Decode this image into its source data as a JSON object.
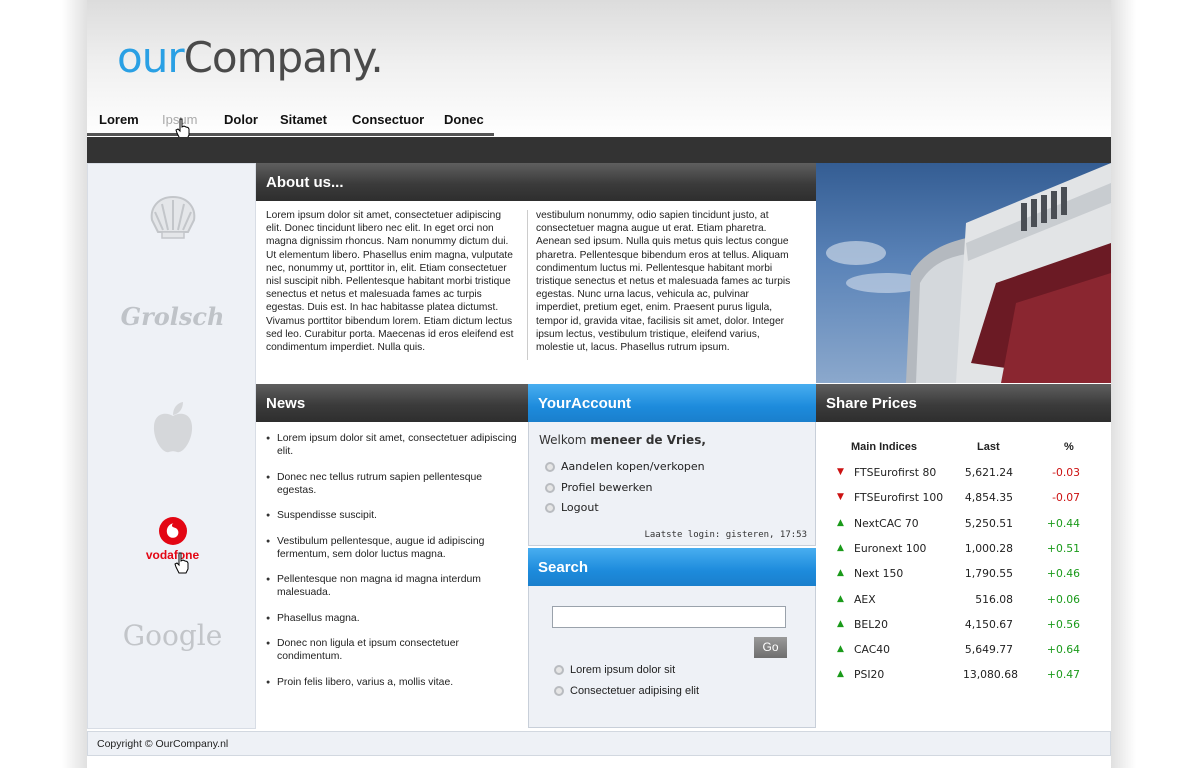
{
  "logo": {
    "part1": "our",
    "part2": "Company."
  },
  "nav": [
    "Lorem",
    "Ipsum",
    "Dolor",
    "Sitamet",
    "Consectuor",
    "Donec"
  ],
  "about": {
    "title": "About us...",
    "col1": "Lorem ipsum dolor sit amet, consectetuer adipiscing elit. Donec tincidunt libero nec elit. In eget orci non magna dignissim rhoncus. Nam nonummy dictum dui. Ut elementum libero. Phasellus enim magna, vulputate nec, nonummy ut, porttitor in, elit. Etiam consectetuer nisl suscipit nibh. Pellentesque habitant morbi tristique senectus et netus et malesuada fames ac turpis egestas. Duis est. In hac habitasse platea dictumst. Vivamus porttitor bibendum lorem. Etiam dictum lectus sed leo. Curabitur porta. Maecenas id eros eleifend est condimentum imperdiet. Nulla quis.",
    "col2": "vestibulum nonummy, odio sapien tincidunt justo, at consectetuer magna augue ut erat. Etiam pharetra. Aenean sed ipsum. Nulla quis metus quis lectus congue pharetra. Pellentesque bibendum eros at tellus. Aliquam condimentum luctus mi. Pellentesque habitant morbi tristique senectus et netus et malesuada fames ac turpis egestas. Nunc urna lacus, vehicula ac, pulvinar imperdiet, pretium eget, enim. Praesent purus ligula, tempor id, gravida vitae, facilisis sit amet, dolor. Integer ipsum lectus, vestibulum tristique, eleifend varius, molestie ut, lacus. Phasellus rutrum ipsum."
  },
  "brands": [
    "Grolsch",
    "vodafone",
    "Google"
  ],
  "news": {
    "title": "News",
    "items": [
      "Lorem ipsum dolor sit amet, consectetuer adipiscing elit.",
      "Donec nec tellus rutrum sapien pellentesque egestas.",
      "Suspendisse suscipit.",
      "Vestibulum pellentesque, augue id adipiscing fermentum, sem dolor luctus magna.",
      "Pellentesque non magna id magna interdum malesuada.",
      "Phasellus magna.",
      "Donec non ligula et ipsum consectetuer condimentum.",
      "Proin felis libero, varius a, mollis vitae."
    ]
  },
  "account": {
    "title": "YourAccount",
    "welcome_prefix": "Welkom",
    "welcome_name": "meneer de Vries,",
    "links": [
      "Aandelen kopen/verkopen",
      "Profiel bewerken",
      "Logout"
    ],
    "last_login": "Laatste login: gisteren, 17:53"
  },
  "search": {
    "title": "Search",
    "value": "",
    "placeholder": "",
    "button": "Go",
    "links": [
      "Lorem ipsum dolor sit",
      "Consectetuer adipising elit"
    ]
  },
  "share": {
    "title": "Share Prices",
    "headers": [
      "Main Indices",
      "Last",
      "%"
    ],
    "rows": [
      {
        "name": "FTSEurofirst 80",
        "last": "5,621.24",
        "pct": "-0.03",
        "dir": "down"
      },
      {
        "name": "FTSEurofirst 100",
        "last": "4,854.35",
        "pct": "-0.07",
        "dir": "down"
      },
      {
        "name": "NextCAC 70",
        "last": "5,250.51",
        "pct": "+0.44",
        "dir": "up"
      },
      {
        "name": "Euronext 100",
        "last": "1,000.28",
        "pct": "+0.51",
        "dir": "up"
      },
      {
        "name": "Next 150",
        "last": "1,790.55",
        "pct": "+0.46",
        "dir": "up"
      },
      {
        "name": "AEX",
        "last": "516.08",
        "pct": "+0.06",
        "dir": "up"
      },
      {
        "name": "BEL20",
        "last": "4,150.67",
        "pct": "+0.56",
        "dir": "up"
      },
      {
        "name": "CAC40",
        "last": "5,649.77",
        "pct": "+0.64",
        "dir": "up"
      },
      {
        "name": "PSI20",
        "last": "13,080.68",
        "pct": "+0.47",
        "dir": "up"
      }
    ],
    "colors": {
      "up": "#1a9a1a",
      "down": "#cc1111"
    }
  },
  "footer": "Copyright © OurCompany.nl"
}
